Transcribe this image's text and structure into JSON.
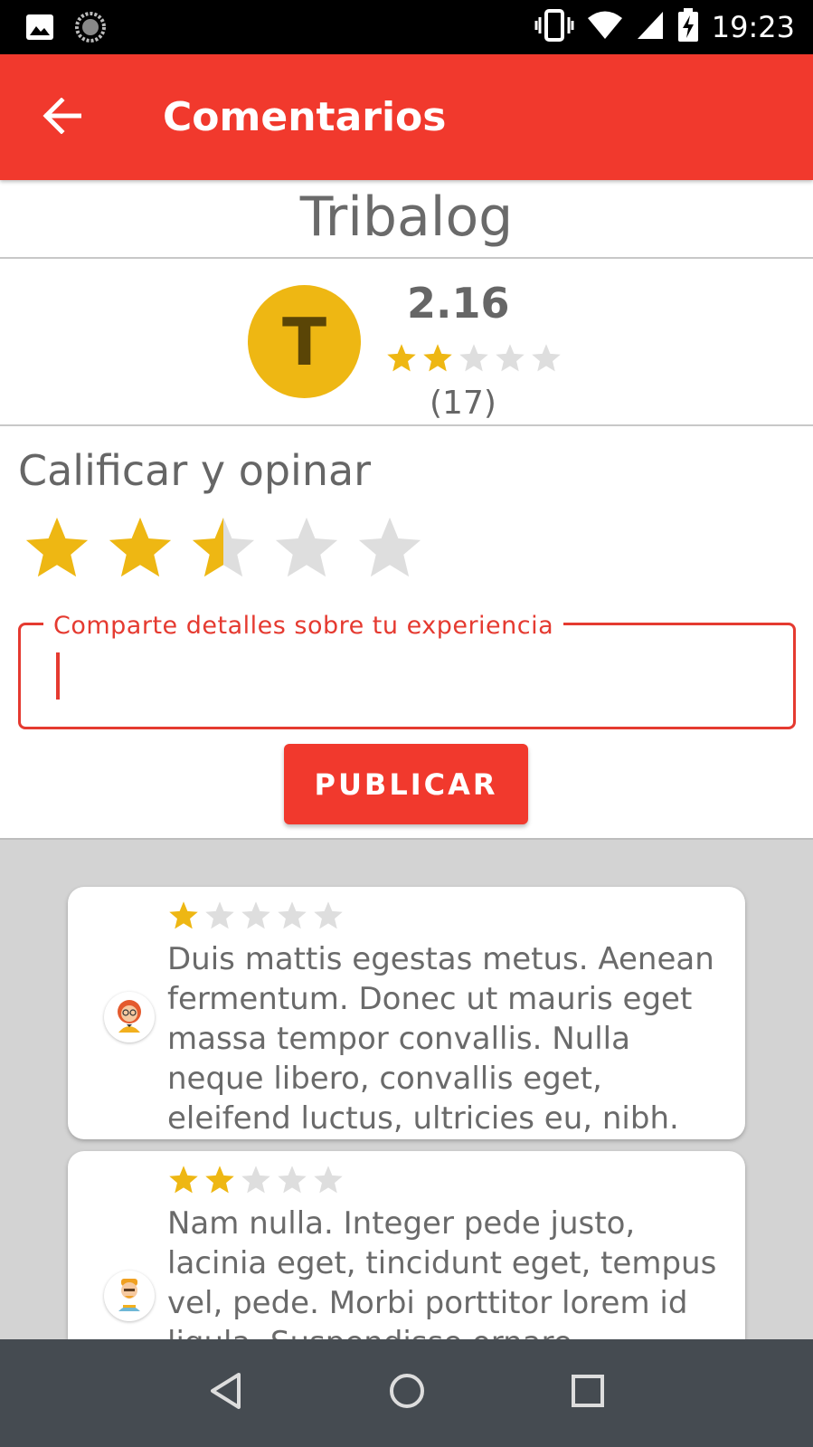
{
  "status_bar": {
    "time": "19:23"
  },
  "app_bar": {
    "title": "Comentarios"
  },
  "company": {
    "name": "Tribalog",
    "initial": "T",
    "score": "2.16",
    "stars": 2,
    "count": "(17)"
  },
  "rate": {
    "title": "Calificar y opinar",
    "value": 2.5,
    "field_label": "Comparte detalles sobre tu experiencia",
    "field_value": "",
    "publish_label": "PUBLICAR"
  },
  "comments": [
    {
      "stars": 1,
      "text": "Duis mattis egestas metus. Aenean fermentum. Donec ut mauris eget massa tempor convallis. Nulla neque libero, convallis eget, eleifend luctus, ultricies eu, nibh."
    },
    {
      "stars": 2,
      "text": "Nam nulla. Integer pede justo, lacinia eget, tincidunt eget, tempus vel, pede. Morbi porttitor lorem id ligula. Suspendisse ornare consequat lectus."
    }
  ],
  "colors": {
    "primary": "#f1392d",
    "star_filled": "#eeb713",
    "star_empty": "#dedede",
    "avatar_bg": "#eeb713"
  }
}
